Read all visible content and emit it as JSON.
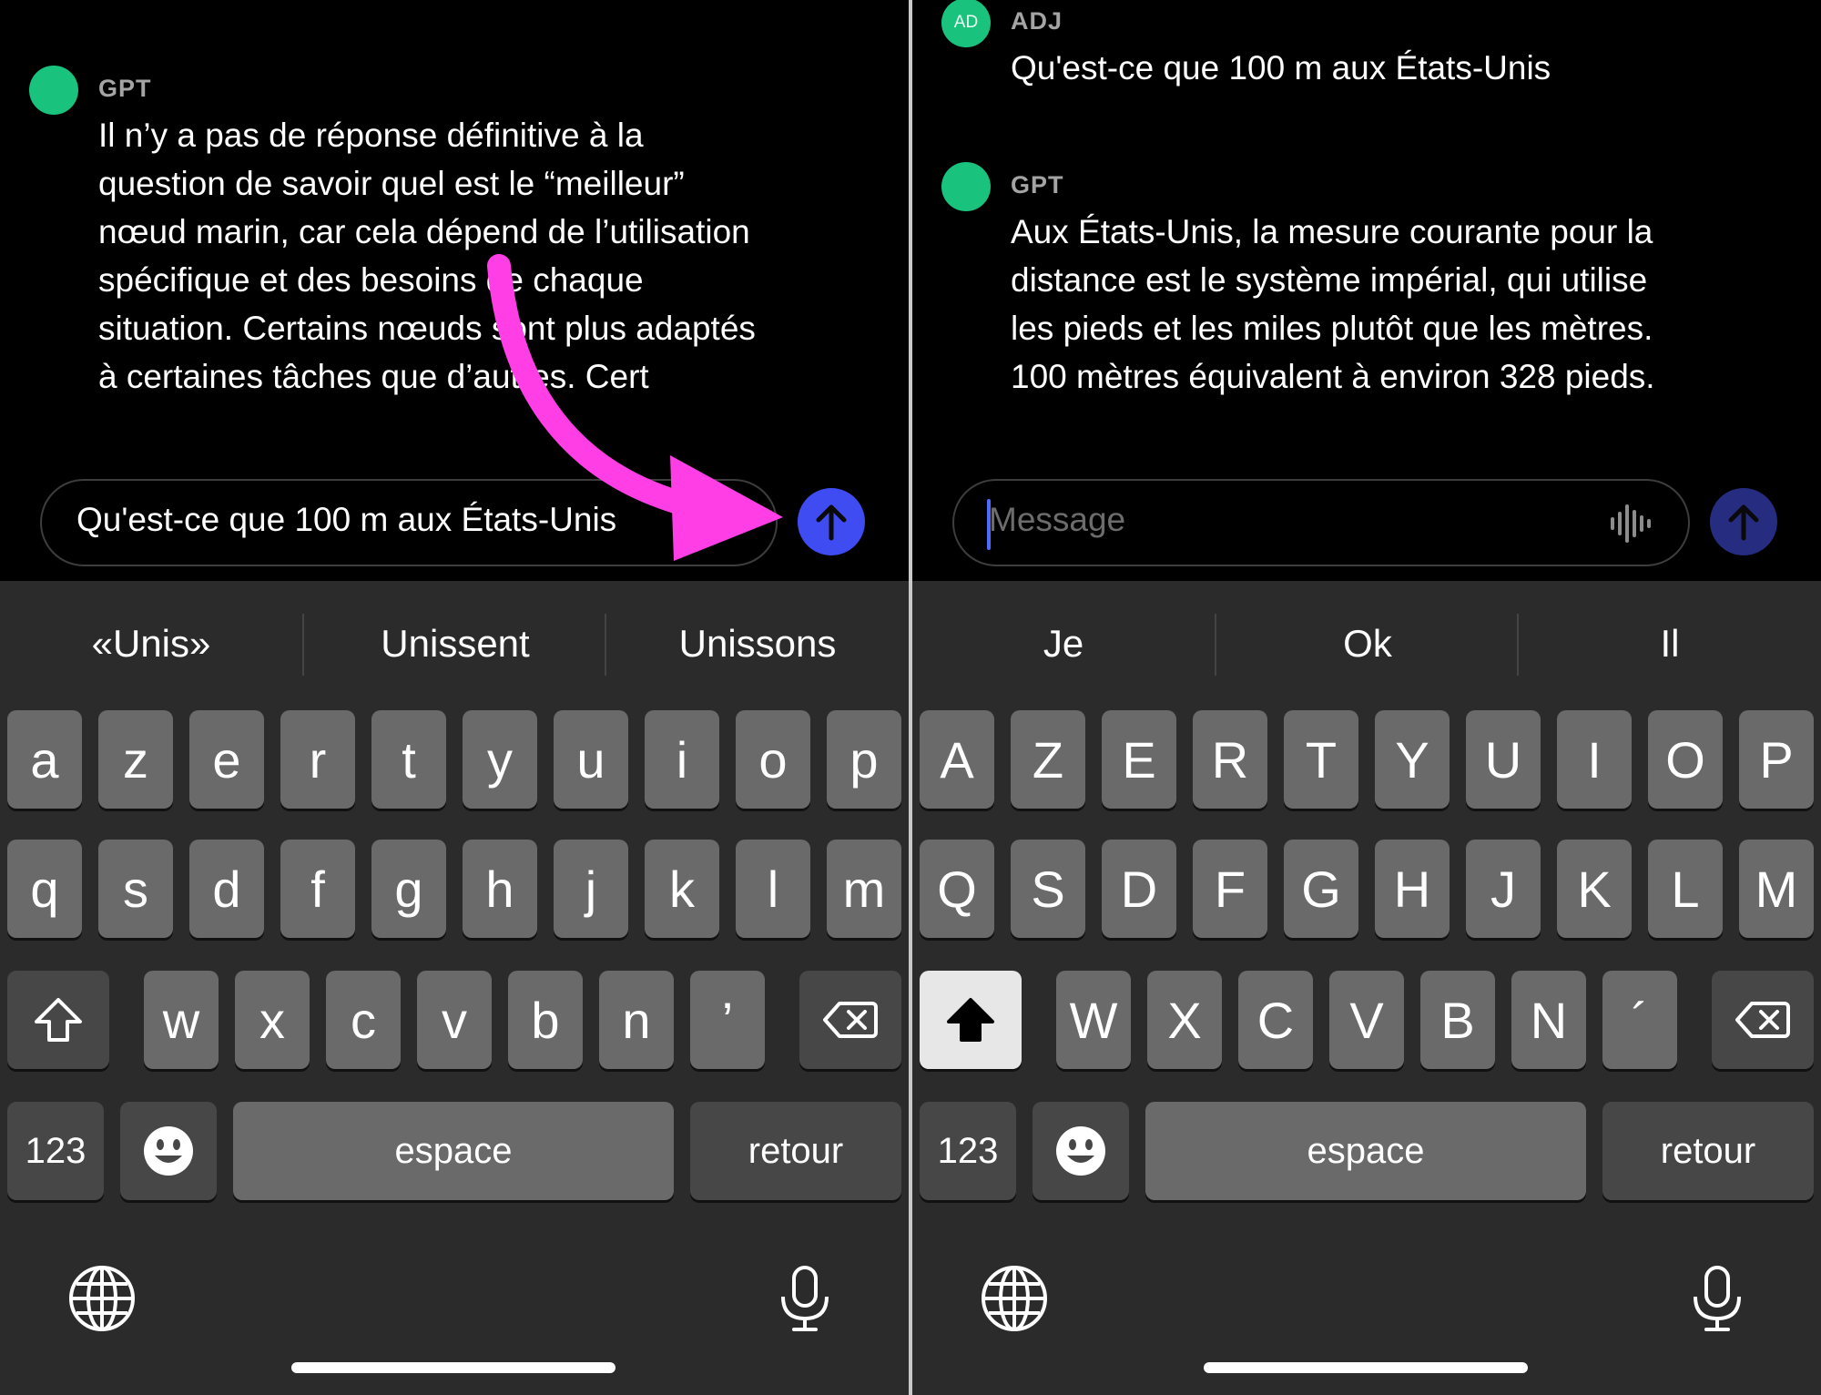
{
  "left": {
    "message": {
      "sender": "GPT",
      "lines": [
        "Il n’y a pas de réponse définitive à la",
        "question de savoir quel est le “meilleur”",
        "nœud marin, car cela dépend de l’utilisation",
        "spécifique et des besoins de chaque",
        "situation. Certains nœuds sont plus adaptés",
        "à certaines tâches que d’autres. Cert"
      ]
    },
    "input_value": "Qu'est-ce que 100 m aux États-Unis",
    "suggestions": [
      "«Unis»",
      "Unissent",
      "Unissons"
    ],
    "rows": [
      [
        "a",
        "z",
        "e",
        "r",
        "t",
        "y",
        "u",
        "i",
        "o",
        "p"
      ],
      [
        "q",
        "s",
        "d",
        "f",
        "g",
        "h",
        "j",
        "k",
        "l",
        "m"
      ],
      [
        "w",
        "x",
        "c",
        "v",
        "b",
        "n",
        "’"
      ]
    ],
    "numbers_key": "123",
    "space_key": "espace",
    "return_key": "retour",
    "arrow_color": "#ff3ee6"
  },
  "right": {
    "user_message": {
      "avatar_initials": "AD",
      "sender": "ADJ",
      "text": "Qu'est-ce que 100 m aux États-Unis"
    },
    "reply": {
      "sender": "GPT",
      "lines": [
        "Aux États-Unis, la mesure courante pour la",
        "distance est le système impérial, qui utilise",
        "les pieds et les miles plutôt que les mètres.",
        "100 mètres équivalent à environ 328 pieds."
      ]
    },
    "input_placeholder": "Message",
    "suggestions": [
      "Je",
      "Ok",
      "Il"
    ],
    "rows": [
      [
        "A",
        "Z",
        "E",
        "R",
        "T",
        "Y",
        "U",
        "I",
        "O",
        "P"
      ],
      [
        "Q",
        "S",
        "D",
        "F",
        "G",
        "H",
        "J",
        "K",
        "L",
        "M"
      ],
      [
        "W",
        "X",
        "C",
        "V",
        "B",
        "N",
        "´"
      ]
    ],
    "numbers_key": "123",
    "space_key": "espace",
    "return_key": "retour"
  },
  "colors": {
    "avatar": "#19c37d",
    "send_active": "#3e4cf2",
    "send_dim": "#262c80",
    "keyboard_bg": "#2b2b2b"
  }
}
